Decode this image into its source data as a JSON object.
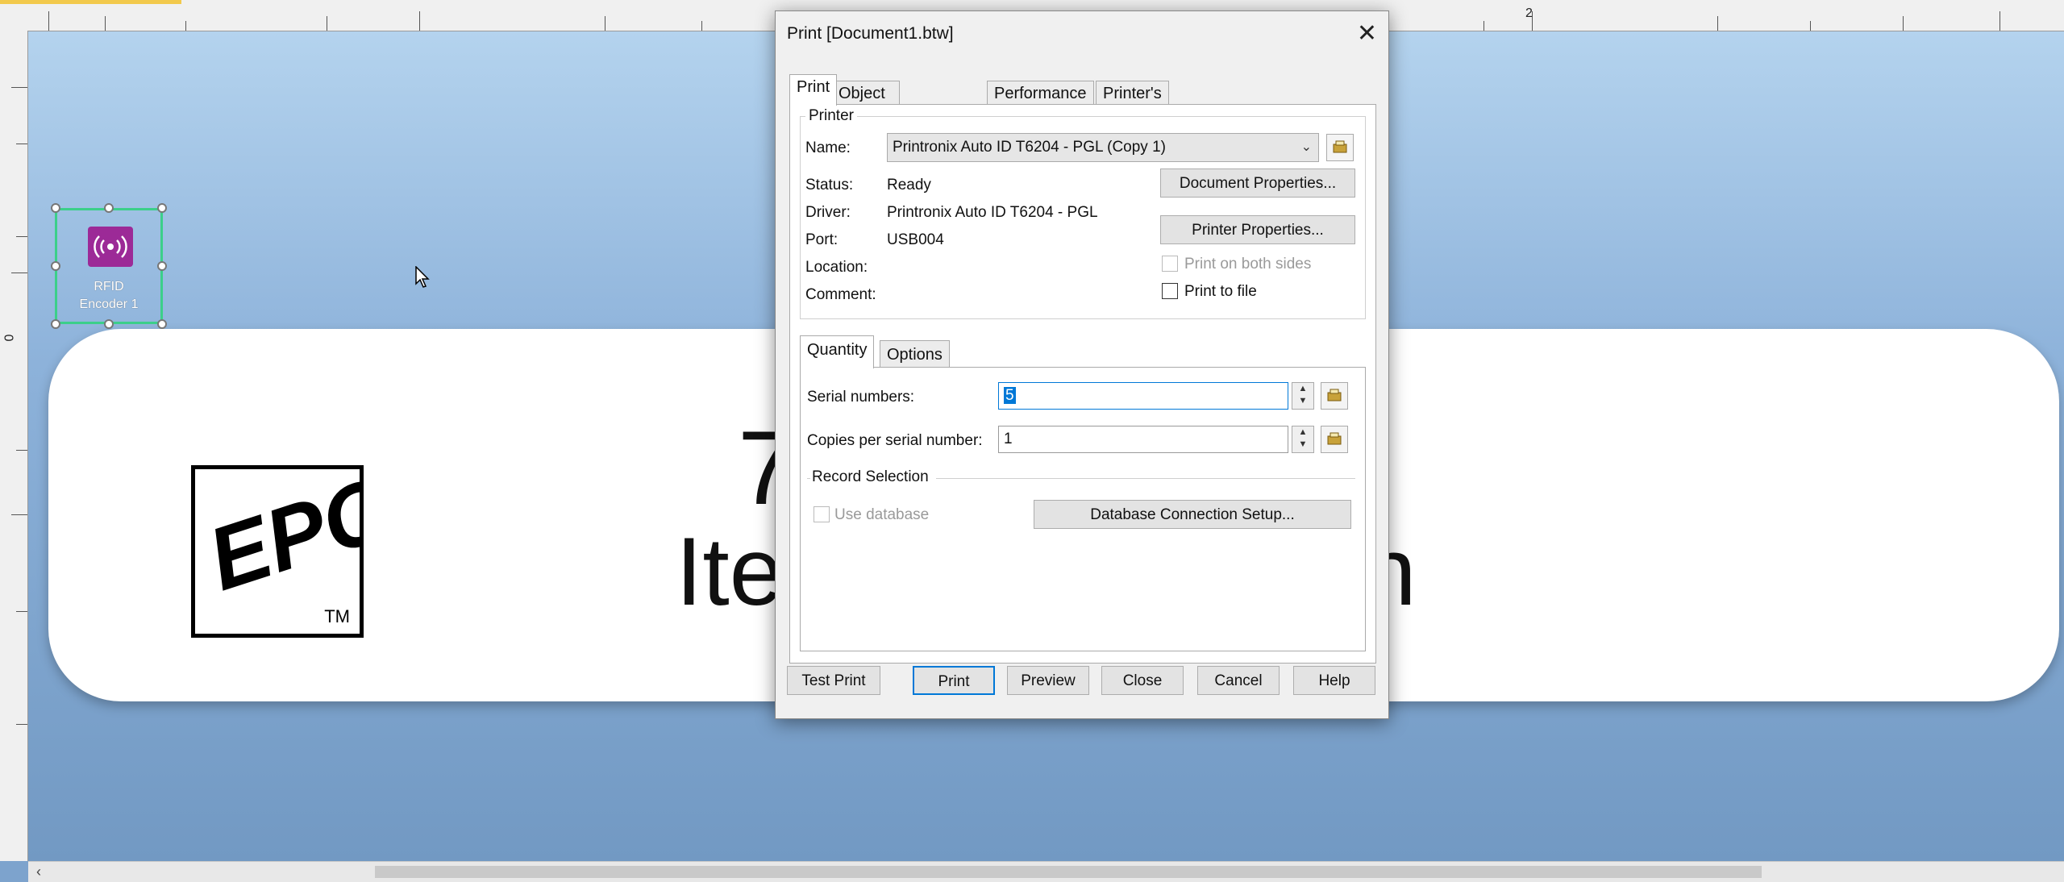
{
  "ruler": {
    "top_numbers": [
      "2"
    ],
    "left_numbers": [
      "0"
    ]
  },
  "label": {
    "rfid_text_line1": "RFID",
    "rfid_text_line2": "Encoder 1",
    "epc_letters": "EPC",
    "epc_tm": "TM",
    "bg_text_seven": "7",
    "bg_text_item": "Ite",
    "bg_text_n": "n"
  },
  "dialog": {
    "title": "Print [Document1.btw]",
    "close_glyph": "✕",
    "tabs": [
      "Print",
      "Object Print Method",
      "Performance",
      "Printer's Cache"
    ],
    "active_tab": "Print",
    "printer": {
      "legend": "Printer",
      "name_label": "Name:",
      "name_value": "Printronix Auto ID T6204 - PGL (Copy 1)",
      "status_label": "Status:",
      "status_value": "Ready",
      "driver_label": "Driver:",
      "driver_value": "Printronix Auto ID T6204 - PGL",
      "port_label": "Port:",
      "port_value": "USB004",
      "location_label": "Location:",
      "comment_label": "Comment:",
      "document_properties_label": "Document Properties...",
      "printer_properties_label": "Printer Properties...",
      "print_both_sides_label": "Print on both sides",
      "print_to_file_label": "Print to file"
    },
    "subtabs": [
      "Quantity",
      "Options"
    ],
    "active_subtab": "Quantity",
    "quantity": {
      "serial_label": "Serial numbers:",
      "serial_value": "5",
      "copies_label": "Copies per serial number:",
      "copies_value": "1",
      "record_selection_label": "Record Selection",
      "use_database_label": "Use database",
      "db_setup_label": "Database Connection Setup..."
    },
    "buttons": {
      "test_print": "Test Print",
      "print": "Print",
      "preview": "Preview",
      "close": "Close",
      "cancel": "Cancel",
      "help": "Help"
    }
  },
  "colors": {
    "accent": "#0078d7",
    "rfid_icon": "#9c2a97",
    "selection": "#3ccf8a"
  }
}
